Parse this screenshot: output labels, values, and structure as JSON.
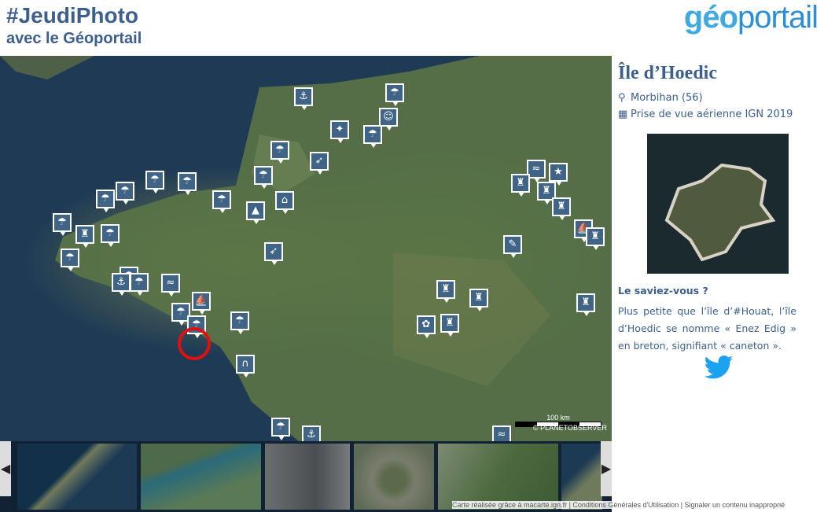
{
  "header": {
    "title": "#JeudiPhoto",
    "subtitle": "avec le Géoportail",
    "logo_part1": "géo",
    "logo_part2": "portail"
  },
  "map": {
    "scale_label": "100 km",
    "attribution": "© PLANETOBSERVER"
  },
  "panel": {
    "place": "Île d’Hoedic",
    "department": "Morbihan (56)",
    "photo_caption": "Prise de vue aérienne IGN 2019",
    "know_heading": "Le saviez-vous ?",
    "text": "Plus petite que l’île d’#Houat, l’île d’Hoedic se nomme « Enez Edig » en breton, signifiant « caneton »."
  },
  "footer": {
    "text": "Carte réalisée grâce à macarte.ign.fr | Conditions Générales d'Utilisation | Signaler un contenu inapproprié"
  },
  "icons": {
    "location": "map-marker-icon",
    "calendar": "calendar-icon",
    "twitter": "twitter-icon"
  },
  "colors": {
    "brand": "#3c5f8d",
    "marker": "#3f6486",
    "highlight": "#e01010",
    "twitter": "#1da1f2"
  }
}
